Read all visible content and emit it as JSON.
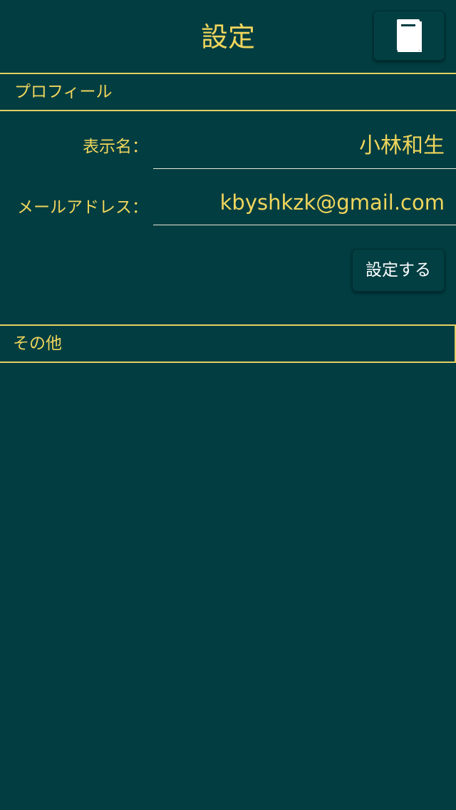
{
  "header": {
    "title": "設定",
    "book_button_icon": "book-icon"
  },
  "profile": {
    "section_label": "プロフィール",
    "display_name_label": "表示名：",
    "display_name_value": "小林和生",
    "email_label": "メールアドレス：",
    "email_value": "kbyshkzk@gmail.com",
    "submit_label": "設定する"
  },
  "other": {
    "section_label": "その他"
  },
  "colors": {
    "background": "#013d41",
    "accent": "#f0d55c",
    "button_text": "#ffffff"
  }
}
